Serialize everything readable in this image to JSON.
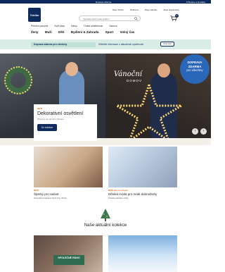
{
  "topbar": {
    "center": "Doprava zdarma",
    "right": "Průvodce a kontakty"
  },
  "header": {
    "logo_text": "Tchibo",
    "search_placeholder": "Vyhledat zboží nebo službu...",
    "links": [
      "Moje Tchibo",
      "Oblíbené",
      "Moje nabídky",
      "Moje objednávky"
    ],
    "cart_count": "0"
  },
  "subnav": [
    "Všechny kategorie",
    "Tchibo Family",
    "Pečení",
    "Vánoce"
  ],
  "subnav_left": [
    "Přehled položek",
    "Svět kávy",
    "Dárky",
    "Trvalá udržitelnost"
  ],
  "mainnav": [
    "Ženy",
    "Muži",
    "Děti",
    "Bydlení & Zahrada",
    "Sport",
    "Volný čas"
  ],
  "banner": {
    "left": "Doprava zdarma pro všechny",
    "middle": "Důležité informace o aktuálních opatřeních",
    "button": "Více info"
  },
  "hero": {
    "headline_script": "Vánoční",
    "headline_sub": "DOMOV",
    "promo_circle": [
      "DOPRAVA",
      "ZDARMA",
      "pro všechny"
    ],
    "card_badge": "NEW",
    "card_title": "Dekorativní osvětlení",
    "card_sub": "Přípravy na vánoční Vánoce",
    "card_button": "Do kolekce"
  },
  "cards": [
    {
      "tag": "NEW",
      "title": "Šperky pro radost",
      "link": "Kompletní kolekce Nově dny obřad"
    },
    {
      "tag": "NEW  Jen v e-shopu",
      "title": "Dětská móda pro malé dobrodruhy",
      "link": "Kolekce dětské módy"
    }
  ],
  "section_title": "Naše aktuální kolekce",
  "collection_badge": "SPOLEČNÉ RÁNO",
  "colors": {
    "brand_navy": "#0f2a5c",
    "mint": "#d9ece6",
    "promo_blue": "#2b67b8",
    "accent_orange": "#e36a12",
    "collection_green": "#2e6b4f"
  }
}
